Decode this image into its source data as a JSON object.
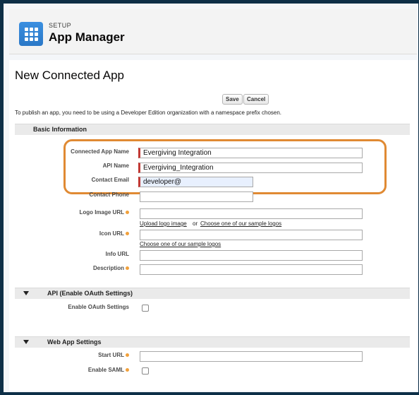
{
  "header": {
    "setup_label": "SETUP",
    "title": "App Manager",
    "icon": "app-launcher-grid-icon"
  },
  "page": {
    "title": "New Connected App",
    "save_label": "Save",
    "cancel_label": "Cancel",
    "intro": "To publish an app, you need to be using a Developer Edition organization with a namespace prefix chosen."
  },
  "basic_info": {
    "section_label": "Basic Information",
    "connected_app_name_label": "Connected App Name",
    "connected_app_name_value": "Evergiving Integration",
    "api_name_label": "API Name",
    "api_name_value": "Evergiving_Integration",
    "contact_email_label": "Contact Email",
    "contact_email_value": "developer@",
    "contact_phone_label": "Contact Phone",
    "logo_image_url_label": "Logo Image URL",
    "upload_logo_link": "Upload logo image",
    "or_text": "or",
    "choose_sample_logos_link": "Choose one of our sample logos",
    "icon_url_label": "Icon URL",
    "choose_sample_logos_link_2": "Choose one of our sample logos",
    "info_url_label": "Info URL",
    "description_label": "Description"
  },
  "api_section": {
    "section_label": "API (Enable OAuth Settings)",
    "enable_oauth_label": "Enable OAuth Settings"
  },
  "web_app_section": {
    "section_label": "Web App Settings",
    "start_url_label": "Start URL",
    "enable_saml_label": "Enable SAML"
  },
  "colors": {
    "highlight": "#e08a33",
    "required": "#c23934",
    "brand": "#2b78c7"
  }
}
